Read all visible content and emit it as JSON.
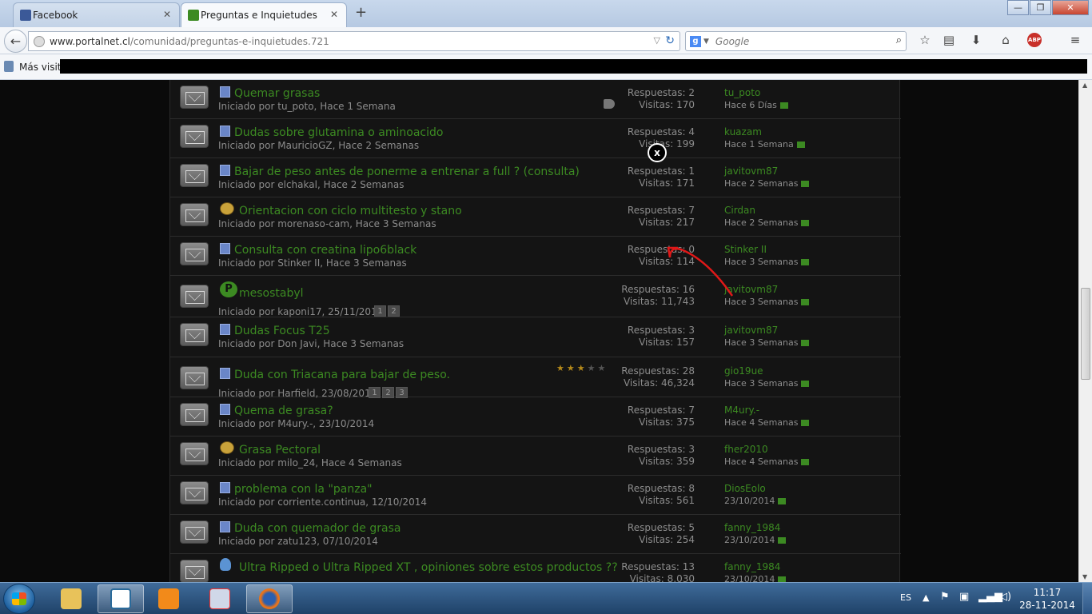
{
  "browser": {
    "tabs": [
      {
        "label": "Facebook",
        "active": false
      },
      {
        "label": "Preguntas e Inquietudes",
        "active": true
      }
    ],
    "url_host": "www.portalnet.cl",
    "url_path": "/comunidad/preguntas-e-inquietudes.721",
    "search_placeholder": "Google",
    "bookmarks_label": "Más visita",
    "win_controls": {
      "minimize": "—",
      "maximize": "❐",
      "close": "✕"
    }
  },
  "threads": [
    {
      "icon": "doc",
      "title": "Quemar grasas",
      "starter": "Iniciado por tu_poto, Hace 1 Semana",
      "replies": "Respuestas: 2",
      "views": "Visitas: 170",
      "last_user": "tu_poto",
      "last_time": "Hace 6 Días",
      "tag": true
    },
    {
      "icon": "doc",
      "title": "Dudas sobre glutamina o aminoacido",
      "starter": "Iniciado por MauricioGZ, Hace 2 Semanas",
      "replies": "Respuestas: 4",
      "views": "Visitas: 199",
      "last_user": "kuazam",
      "last_time": "Hace 1 Semana"
    },
    {
      "icon": "doc",
      "title": "Bajar de peso antes de ponerme a entrenar a full ? (consulta)",
      "starter": "Iniciado por elchakal, Hace 2 Semanas",
      "replies": "Respuestas: 1",
      "views": "Visitas: 171",
      "last_user": "javitovm87",
      "last_time": "Hace 2 Semanas"
    },
    {
      "icon": "emo",
      "title": "Orientacion con ciclo multitesto y stano",
      "starter": "Iniciado por morenaso-cam, Hace 3 Semanas",
      "replies": "Respuestas: 7",
      "views": "Visitas: 217",
      "last_user": "Cirdan",
      "last_time": "Hace 2 Semanas"
    },
    {
      "icon": "doc",
      "title": "Consulta con creatina lipo6black",
      "starter": "Iniciado por Stinker II, Hace 3 Semanas",
      "replies": "Respuestas: 0",
      "views": "Visitas: 114",
      "last_user": "Stinker II",
      "last_time": "Hace 3 Semanas"
    },
    {
      "icon": "p",
      "title": "mesostabyl",
      "starter": "Iniciado por kaponi17, 25/11/2013",
      "pages": [
        "1",
        "2"
      ],
      "replies": "Respuestas: 16",
      "views": "Visitas: 11,743",
      "last_user": "javitovm87",
      "last_time": "Hace 3 Semanas"
    },
    {
      "icon": "doc",
      "title": "Dudas Focus T25",
      "starter": "Iniciado por Don Javi, Hace 3 Semanas",
      "replies": "Respuestas: 3",
      "views": "Visitas: 157",
      "last_user": "javitovm87",
      "last_time": "Hace 3 Semanas"
    },
    {
      "icon": "doc",
      "title": "Duda con Triacana para bajar de peso.",
      "starter": "Iniciado por Harfield, 23/08/2012",
      "pages": [
        "1",
        "2",
        "3"
      ],
      "rating": 3,
      "replies": "Respuestas: 28",
      "views": "Visitas: 46,324",
      "last_user": "gio19ue",
      "last_time": "Hace 3 Semanas"
    },
    {
      "icon": "doc",
      "title": "Quema de grasa?",
      "starter": "Iniciado por M4ury.-, 23/10/2014",
      "replies": "Respuestas: 7",
      "views": "Visitas: 375",
      "last_user": "M4ury.-",
      "last_time": "Hace 4 Semanas"
    },
    {
      "icon": "emo",
      "title": "Grasa Pectoral",
      "starter": "Iniciado por milo_24, Hace 4 Semanas",
      "replies": "Respuestas: 3",
      "views": "Visitas: 359",
      "last_user": "fher2010",
      "last_time": "Hace 4 Semanas"
    },
    {
      "icon": "doc",
      "title": "problema con la \"panza\"",
      "starter": "Iniciado por corriente.continua, 12/10/2014",
      "replies": "Respuestas: 8",
      "views": "Visitas: 561",
      "last_user": "DiosEolo",
      "last_time": "23/10/2014"
    },
    {
      "icon": "doc",
      "title": "Duda con quemador de grasa",
      "starter": "Iniciado por zatu123, 07/10/2014",
      "replies": "Respuestas: 5",
      "views": "Visitas: 254",
      "last_user": "fanny_1984",
      "last_time": "23/10/2014"
    },
    {
      "icon": "bulb",
      "title": "Ultra Ripped o Ultra Ripped XT , opiniones sobre estos productos ??",
      "starter": "",
      "replies": "Respuestas: 13",
      "views": "Visitas: 8,030",
      "last_user": "fanny_1984",
      "last_time": "23/10/2014"
    }
  ],
  "overlay": {
    "close_label": "x"
  },
  "taskbar": {
    "lang": "ES",
    "time": "11:17",
    "date": "28-11-2014"
  },
  "colors": {
    "link": "#3c8a22",
    "muted": "#8c8c8c",
    "bg": "#141414"
  }
}
